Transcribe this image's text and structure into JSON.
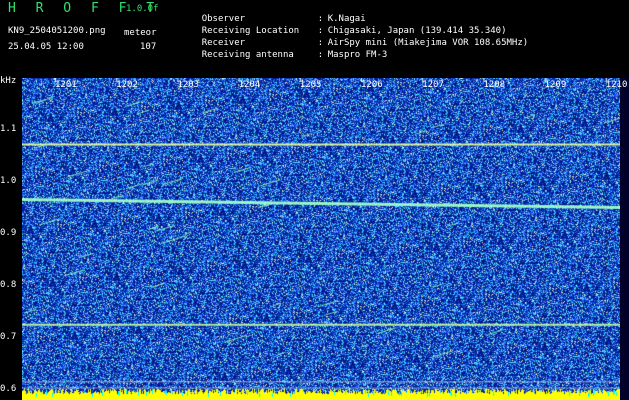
{
  "header": {
    "app_title": "H R O F F T",
    "version": "1.0.0f",
    "filename": "KN9_2504051200.png",
    "datetime": "25.04.05 12:00",
    "mode_label": "meteor",
    "count": "107"
  },
  "meta": [
    {
      "key": "Observer",
      "value": "K.Nagai"
    },
    {
      "key": "Receiving Location",
      "value": "Chigasaki, Japan (139.414 35.340)"
    },
    {
      "key": "Receiver",
      "value": "AirSpy mini (Miakejima VOR 108.65MHz)"
    },
    {
      "key": "Receiving antenna",
      "value": "Maspro FM-3"
    }
  ],
  "chart_data": {
    "type": "heatmap",
    "ylabel": "kHz",
    "y_ticks": [
      "1.1",
      "1.0",
      "0.9",
      "0.8",
      "0.7",
      "0.6"
    ],
    "x_ticks": [
      "1201",
      "1202",
      "1203",
      "1204",
      "1205",
      "1206",
      "1207",
      "1208",
      "1209",
      "1210"
    ],
    "ylim": [
      0.58,
      1.2
    ],
    "colors": {
      "background": "#0a1a8a",
      "noise": "#4aa0ff",
      "signal": "#ffff60",
      "bottom_bar": "#ffff00"
    }
  }
}
